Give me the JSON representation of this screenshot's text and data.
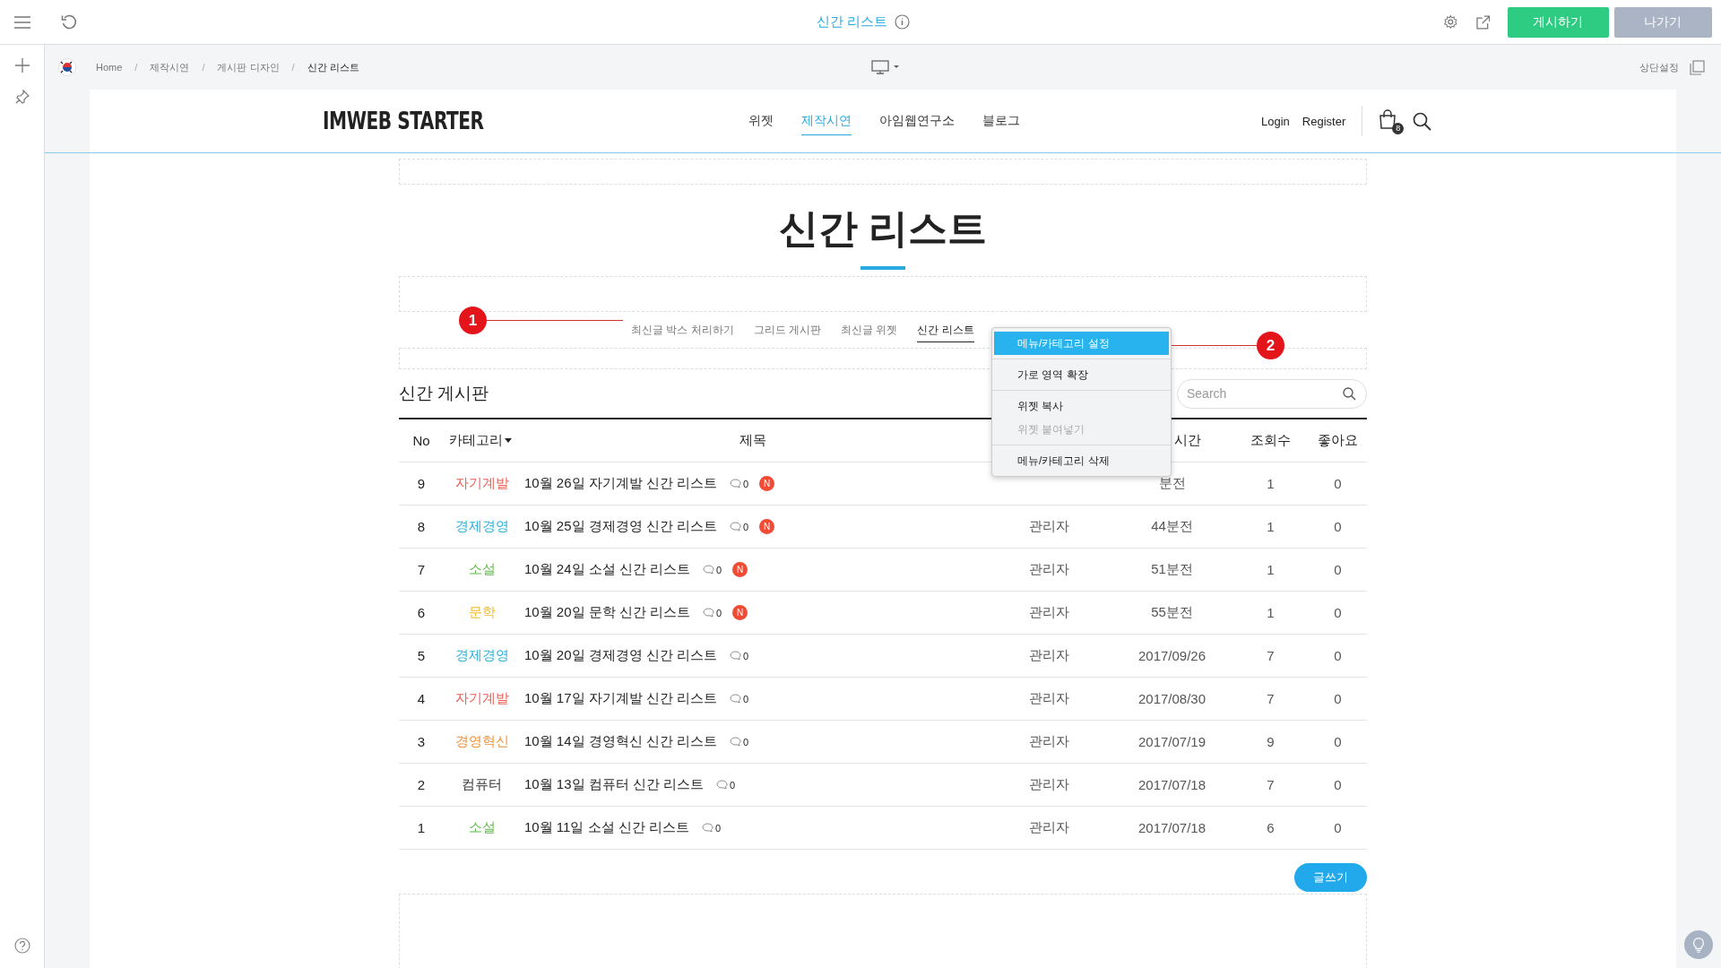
{
  "topbar": {
    "title": "신간 리스트",
    "publish": "게시하기",
    "exit": "나가기"
  },
  "breadcrumb": [
    "Home",
    "제작시연",
    "게시판 디자인",
    "신간 리스트"
  ],
  "breadcrumb_separator": "/",
  "top_settings": "상단설정",
  "header": {
    "logo": "IMWEB STARTER",
    "nav": [
      {
        "label": "위젯",
        "selected": false
      },
      {
        "label": "제작시연",
        "selected": true
      },
      {
        "label": "아임웹연구소",
        "selected": false
      },
      {
        "label": "블로그",
        "selected": false
      }
    ],
    "login": "Login",
    "register": "Register",
    "cart_count": "8"
  },
  "page_title": "신간 리스트",
  "tabs": [
    {
      "label": "최신글 박스 처리하기",
      "selected": false
    },
    {
      "label": "그리드 게시판",
      "selected": false
    },
    {
      "label": "최신글 위젯",
      "selected": false
    },
    {
      "label": "신간 리스트",
      "selected": true
    }
  ],
  "annotations": [
    "1",
    "2"
  ],
  "context_menu": [
    {
      "label": "메뉴/카테고리 설정",
      "selected": true,
      "disabled": false
    },
    {
      "label": "가로 영역 확장",
      "selected": false,
      "disabled": false
    },
    {
      "label": "위젯 복사",
      "selected": false,
      "disabled": false
    },
    {
      "label": "위젯 붙여넣기",
      "selected": false,
      "disabled": true
    },
    {
      "label": "메뉴/카테고리 삭제",
      "selected": false,
      "disabled": false
    }
  ],
  "board": {
    "title": "신간 게시판",
    "search": {
      "placeholder": "Search"
    },
    "columns": [
      {
        "label": "No"
      },
      {
        "label": "카테고리",
        "sort_menu": true
      },
      {
        "label": "제목"
      },
      {},
      {
        "label": "시간"
      },
      {
        "label": "조회수"
      },
      {
        "label": "좋아요"
      }
    ],
    "rows": [
      {
        "no": "9",
        "category": "자기계발",
        "color": "#eb5b50",
        "title": "10월 26일 자기계발 신간 리스트",
        "comments": "0",
        "badge": "N",
        "time": "분전",
        "views": "1",
        "likes": "0"
      },
      {
        "no": "8",
        "category": "경제경영",
        "color": "#2cb0e0",
        "title": "10월 25일 경제경영 신간 리스트",
        "comments": "0",
        "badge": "N",
        "author": "관리자",
        "time": "44분전",
        "views": "1",
        "likes": "0"
      },
      {
        "no": "7",
        "category": "소설",
        "color": "#62b84c",
        "title": "10월 24일 소설 신간 리스트",
        "comments": "0",
        "badge": "N",
        "author": "관리자",
        "time": "51분전",
        "views": "1",
        "likes": "0"
      },
      {
        "no": "6",
        "category": "문학",
        "color": "#f0b82a",
        "title": "10월 20일 문학 신간 리스트",
        "comments": "0",
        "badge": "N",
        "author": "관리자",
        "time": "55분전",
        "views": "1",
        "likes": "0"
      },
      {
        "no": "5",
        "category": "경제경영",
        "color": "#2cb0e0",
        "title": "10월 20일 경제경영 신간 리스트",
        "comments": "0",
        "author": "관리자",
        "time": "2017/09/26",
        "views": "7",
        "likes": "0"
      },
      {
        "no": "4",
        "category": "자기계발",
        "color": "#eb5b50",
        "title": "10월 17일 자기계발 신간 리스트",
        "comments": "0",
        "author": "관리자",
        "time": "2017/08/30",
        "views": "7",
        "likes": "0"
      },
      {
        "no": "3",
        "category": "경영혁신",
        "color": "#f0923a",
        "title": "10월 14일 경영혁신 신간 리스트",
        "comments": "0",
        "author": "관리자",
        "time": "2017/07/19",
        "views": "9",
        "likes": "0"
      },
      {
        "no": "2",
        "category": "컴퓨터",
        "color": "#333333",
        "title": "10월 13일 컴퓨터 신간 리스트",
        "comments": "0",
        "author": "관리자",
        "time": "2017/07/18",
        "views": "7",
        "likes": "0"
      },
      {
        "no": "1",
        "category": "소설",
        "color": "#62b84c",
        "title": "10월 11일 소설 신간 리스트",
        "comments": "0",
        "author": "관리자",
        "time": "2017/07/18",
        "views": "6",
        "likes": "0"
      }
    ],
    "write_button": "글쓰기"
  }
}
